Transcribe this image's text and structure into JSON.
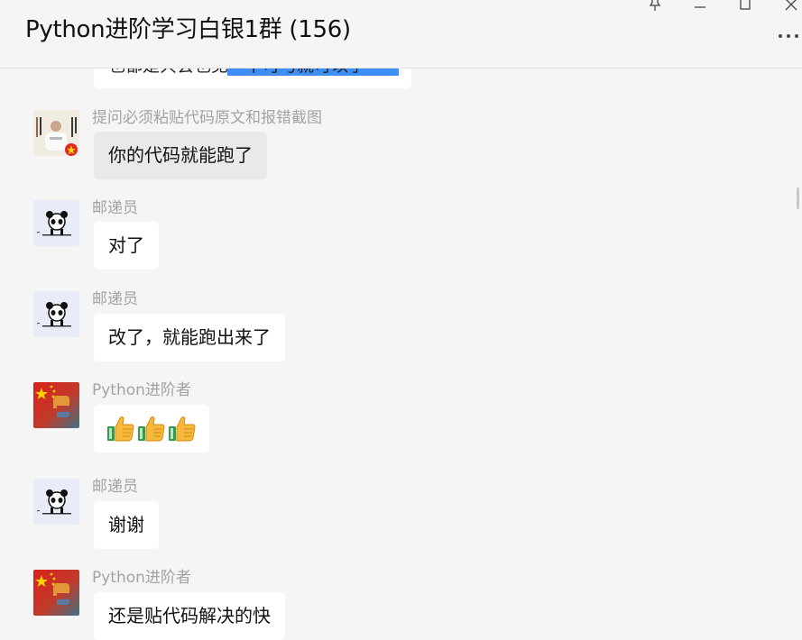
{
  "window": {
    "title": "Python进阶学习白银1群 (156)",
    "controls": [
      "pin-icon",
      "minimize-icon",
      "maximize-icon",
      "close-icon"
    ]
  },
  "partial_message": {
    "text": "也都是共会也见一下可与就可以了"
  },
  "messages": [
    {
      "sender": "提问必须粘贴代码原文和报错截图",
      "text": "你的代码就能跑了",
      "avatar": "calligraphy-person-avatar",
      "bubble_color": "#e9e9e9"
    },
    {
      "sender": "邮递员",
      "text": "对了",
      "avatar": "panda-avatar",
      "bubble_color": "#ffffff"
    },
    {
      "sender": "邮递员",
      "text": "改了，就能跑出来了",
      "avatar": "panda-avatar",
      "bubble_color": "#ffffff"
    },
    {
      "sender": "Python进阶者",
      "text": "",
      "content": [
        "thumbs-up-emoji",
        "thumbs-up-emoji",
        "thumbs-up-emoji"
      ],
      "avatar": "python-flag-avatar",
      "bubble_color": "#ffffff"
    },
    {
      "sender": "邮递员",
      "text": "谢谢",
      "avatar": "panda-avatar",
      "bubble_color": "#ffffff"
    },
    {
      "sender": "Python进阶者",
      "text": "还是贴代码解决的快",
      "avatar": "python-flag-avatar",
      "bubble_color": "#ffffff"
    }
  ],
  "colors": {
    "background": "#f5f5f5",
    "bubble": "#ffffff",
    "bubble_gray": "#e9e9e9",
    "sender": "#a3a3a3",
    "highlight": "#3d8ff5"
  }
}
